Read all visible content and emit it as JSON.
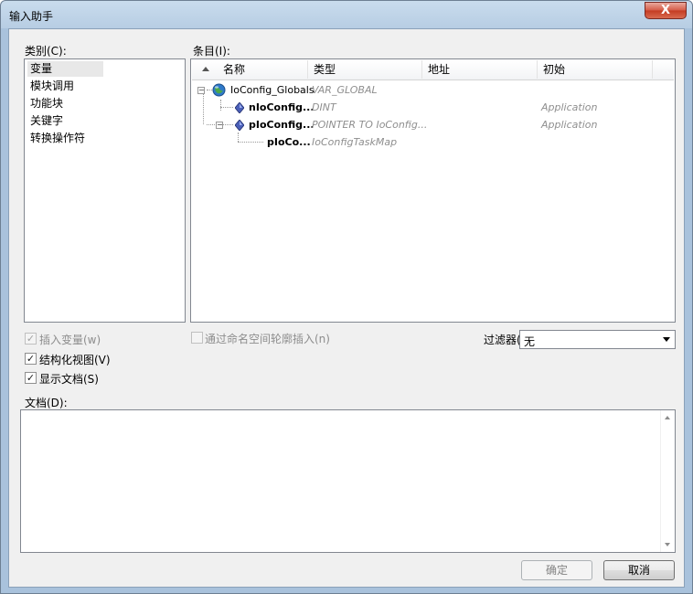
{
  "window": {
    "title": "输入助手",
    "close_glyph": "X"
  },
  "categories": {
    "label": "类别(C):",
    "items": [
      "变量",
      "模块调用",
      "功能块",
      "关键字",
      "转换操作符"
    ],
    "selected_index": 0
  },
  "entries": {
    "label": "条目(I):",
    "columns": [
      "名称",
      "类型",
      "地址",
      "初始"
    ],
    "rows": [
      {
        "name": "IoConfig_Globals",
        "type": "VAR_GLOBAL",
        "address": "",
        "init": ""
      },
      {
        "name": "nIoConfig...",
        "type": "DINT",
        "address": "",
        "init": "Application"
      },
      {
        "name": "pIoConfig...",
        "type": "POINTER TO IoConfig...",
        "address": "",
        "init": "Application"
      },
      {
        "name": "pIoCo...",
        "type": "IoConfigTaskMap",
        "address": "",
        "init": ""
      }
    ]
  },
  "options": {
    "insert_variable": {
      "label": "插入变量(w)",
      "checked": true,
      "enabled": false
    },
    "structured_view": {
      "label": "结构化视图(V)",
      "checked": true,
      "enabled": true
    },
    "show_docs": {
      "label": "显示文档(S)",
      "checked": true,
      "enabled": true
    },
    "namespace_insert": {
      "label": "通过命名空间轮廓插入(n)",
      "checked": false,
      "enabled": false
    }
  },
  "filter": {
    "label": "过滤器(",
    "value": "无"
  },
  "documentation": {
    "label": "文档(D):",
    "text": ""
  },
  "buttons": {
    "ok": "确定",
    "cancel": "取消"
  },
  "icons": {
    "globals": "globe-icon",
    "variable": "diamond-variable-icon",
    "check": "✓"
  }
}
